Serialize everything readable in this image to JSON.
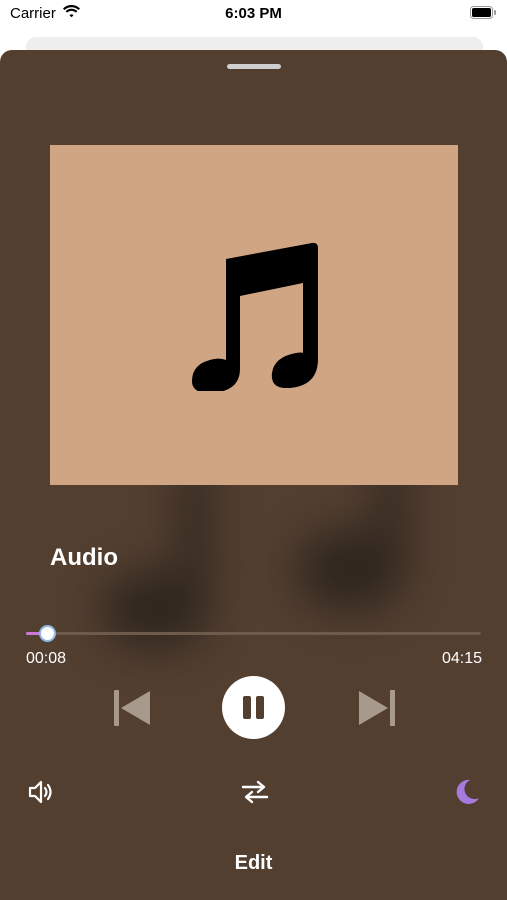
{
  "status_bar": {
    "carrier": "Carrier",
    "time": "6:03 PM"
  },
  "player": {
    "title": "Audio",
    "elapsed": "00:08",
    "duration": "04:15",
    "progress_fraction": 0.047,
    "is_playing": true
  },
  "icons": {
    "wifi": "wifi-icon",
    "battery": "battery-icon",
    "artwork": "music-note-icon",
    "previous": "skip-back-icon",
    "play_pause": "pause-icon",
    "next": "skip-forward-icon",
    "volume": "speaker-icon",
    "shuffle": "shuffle-icon",
    "sleep_timer": "moon-icon"
  },
  "actions": {
    "edit_label": "Edit"
  },
  "colors": {
    "sheet_background": "#533f30",
    "artwork_background": "#d0a584",
    "progress_fill": "#c879d9",
    "moon_accent": "#a77ae0"
  }
}
